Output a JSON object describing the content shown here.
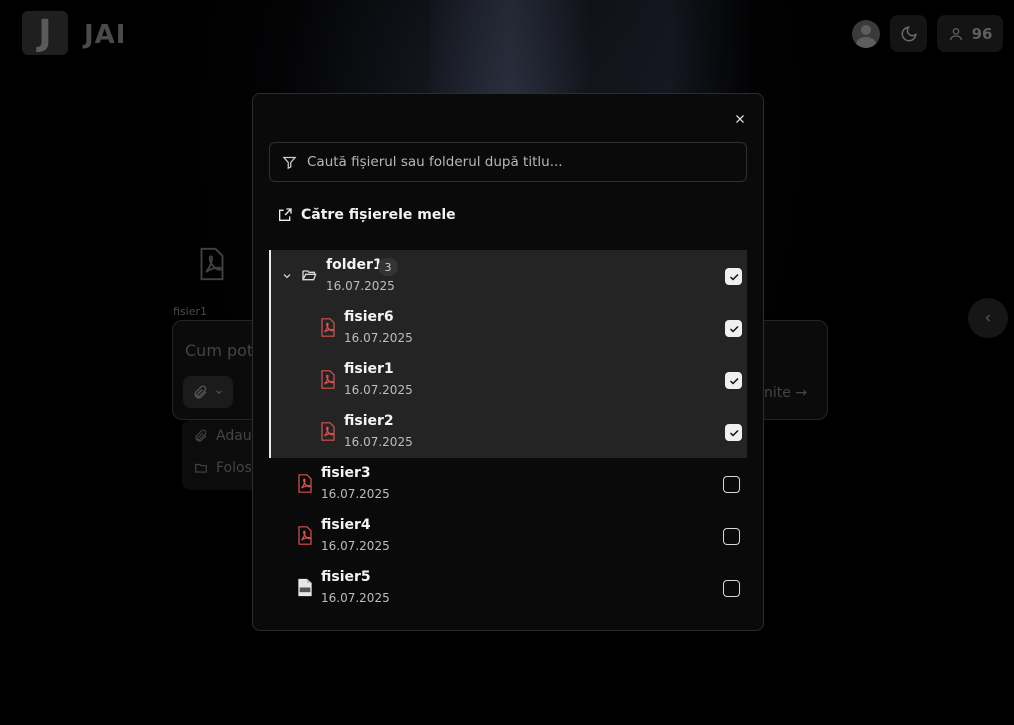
{
  "app": {
    "logo_letter": "J",
    "logo_text": "JAI",
    "credits": "96"
  },
  "background": {
    "attached_file_name": "fisier1",
    "chat_placeholder": "Cum pot",
    "send_hint": "nite",
    "attach_menu": [
      "Adau",
      "Folos"
    ]
  },
  "modal": {
    "search_placeholder": "Caută fișierul sau folderul după titlu...",
    "my_files_link": "Către fișierele mele",
    "folder": {
      "name": "folder1",
      "count": "3",
      "date": "16.07.2025",
      "checked": true,
      "expanded": true
    },
    "folder_items": [
      {
        "name": "fisier6",
        "date": "16.07.2025",
        "type": "pdf",
        "checked": true
      },
      {
        "name": "fisier1",
        "date": "16.07.2025",
        "type": "pdf",
        "checked": true
      },
      {
        "name": "fisier2",
        "date": "16.07.2025",
        "type": "pdf",
        "checked": true
      }
    ],
    "root_items": [
      {
        "name": "fisier3",
        "date": "16.07.2025",
        "type": "pdf",
        "checked": false
      },
      {
        "name": "fisier4",
        "date": "16.07.2025",
        "type": "pdf",
        "checked": false
      },
      {
        "name": "fisier5",
        "date": "16.07.2025",
        "type": "doc",
        "checked": false
      }
    ]
  },
  "colors": {
    "pdf_icon": "#d9534f",
    "selected_bg": "#242424",
    "accent_line": "#e9e9e9"
  }
}
